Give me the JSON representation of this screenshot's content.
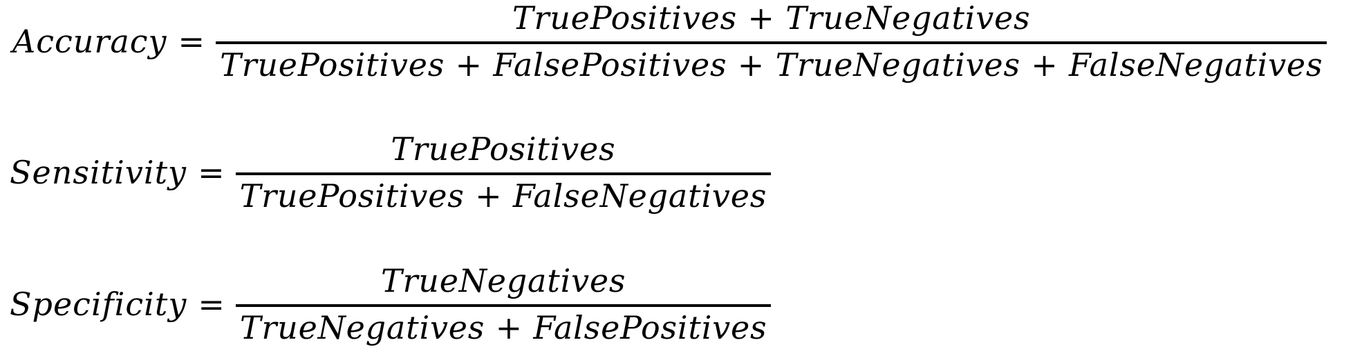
{
  "equations": {
    "accuracy": {
      "lhs": "Accuracy",
      "equals": "=",
      "numerator": "TruePositives + TrueNegatives",
      "denominator": "TruePositives + FalsePositives + TrueNegatives + FalseNegatives"
    },
    "sensitivity": {
      "lhs": "Sensitivity",
      "equals": "=",
      "numerator": "TruePositives",
      "denominator": "TruePositives + FalseNegatives"
    },
    "specificity": {
      "lhs": "Specificity",
      "equals": "=",
      "numerator": "TrueNegatives",
      "denominator": "TrueNegatives + FalsePositives"
    }
  }
}
